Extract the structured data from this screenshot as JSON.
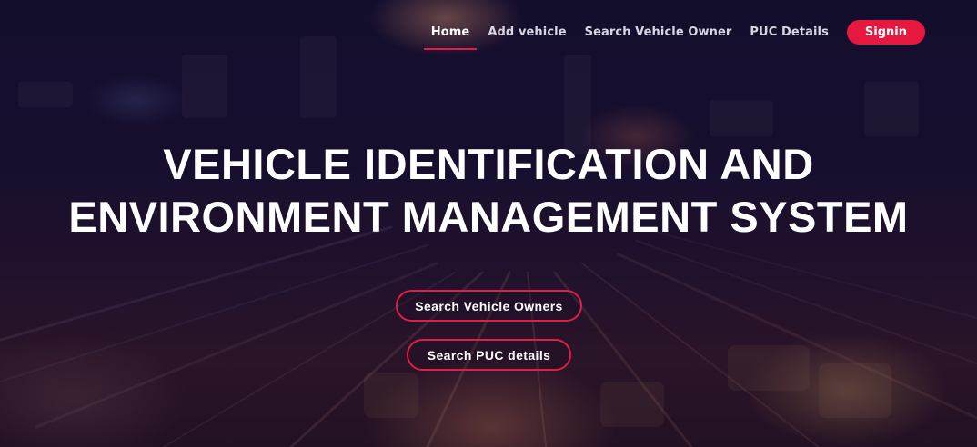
{
  "nav": {
    "items": [
      {
        "label": "Home",
        "active": true
      },
      {
        "label": "Add vehicle",
        "active": false
      },
      {
        "label": "Search Vehicle Owner",
        "active": false
      },
      {
        "label": "PUC Details",
        "active": false
      }
    ],
    "signin_label": "Signin"
  },
  "hero": {
    "title_line1": "VEHICLE IDENTIFICATION AND",
    "title_line2": "ENVIRONMENT MANAGEMENT SYSTEM",
    "buttons": {
      "search_owners_label": "Search Vehicle Owners",
      "search_puc_label": "Search PUC details"
    }
  },
  "colors": {
    "accent": "#e8173f",
    "background": "#1d1233",
    "text": "#ffffff"
  }
}
